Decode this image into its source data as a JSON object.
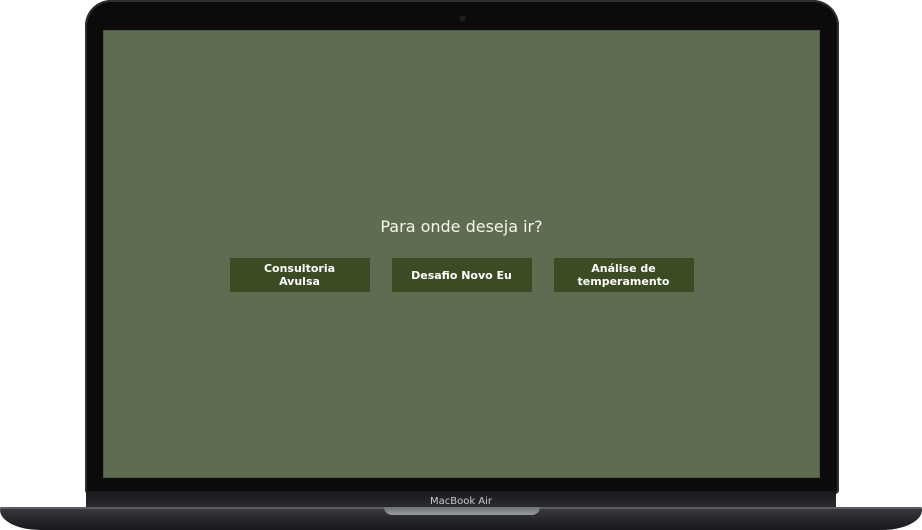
{
  "device": {
    "brand_label": "MacBook Air"
  },
  "page": {
    "prompt": "Para onde deseja ir?",
    "buttons": [
      {
        "label": "Consultoria Avulsa"
      },
      {
        "label": "Desafio Novo Eu"
      },
      {
        "label": "Análise de temperamento"
      }
    ]
  },
  "colors": {
    "background": "#606c51",
    "button": "#3b4b24",
    "text": "#ffffff"
  }
}
